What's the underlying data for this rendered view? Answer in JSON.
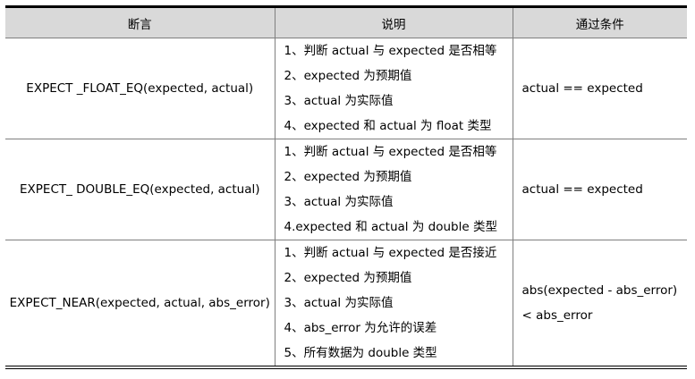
{
  "table": {
    "headers": [
      "断言",
      "说明",
      "通过条件"
    ],
    "rows": [
      {
        "assertion": "EXPECT _FLOAT_EQ(expected, actual)",
        "description": [
          "1、判断 actual 与 expected 是否相等",
          "2、expected 为预期值",
          "3、actual 为实际值",
          "4、expected 和 actual 为 float 类型"
        ],
        "condition": [
          "actual == expected"
        ]
      },
      {
        "assertion": "EXPECT_ DOUBLE_EQ(expected, actual)",
        "description": [
          "1、判断 actual 与 expected 是否相等",
          "2、expected 为预期值",
          "3、actual 为实际值",
          "4.expected 和 actual 为 double 类型"
        ],
        "condition": [
          "actual == expected"
        ]
      },
      {
        "assertion": "EXPECT_NEAR(expected, actual, abs_error)",
        "description": [
          "1、判断 actual 与 expected 是否接近",
          "2、expected 为预期值",
          "3、actual 为实际值",
          "4、abs_error 为允许的误差",
          "5、所有数据为 double 类型"
        ],
        "condition": [
          "abs(expected  -  abs_error)",
          "< abs_error"
        ]
      }
    ]
  }
}
